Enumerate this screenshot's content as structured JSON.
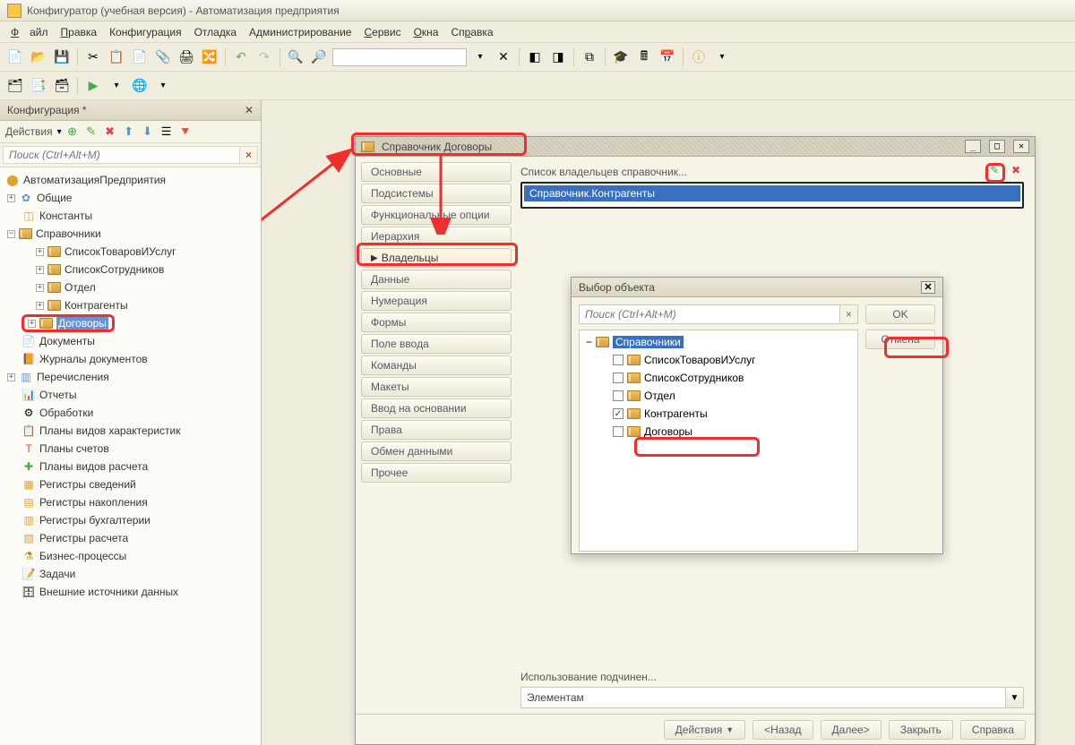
{
  "app": {
    "title": "Конфигуратор (учебная версия) - Автоматизация предприятия"
  },
  "menu": {
    "items": [
      "Файл",
      "Правка",
      "Конфигурация",
      "Отладка",
      "Администрирование",
      "Сервис",
      "Окна",
      "Справка"
    ]
  },
  "toolbar": {
    "search_placeholder": ""
  },
  "config_panel": {
    "title": "Конфигурация *",
    "actions_label": "Действия",
    "search_placeholder": "Поиск (Ctrl+Alt+M)",
    "root": "АвтоматизацияПредприятия",
    "nodes": [
      {
        "label": "Общие",
        "icon": "🔶"
      },
      {
        "label": "Константы",
        "icon": "cat"
      },
      {
        "label": "Справочники",
        "icon": "cat",
        "expanded": true,
        "children": [
          {
            "label": "СписокТоваровИУслуг"
          },
          {
            "label": "СписокСотрудников"
          },
          {
            "label": "Отдел"
          },
          {
            "label": "Контрагенты"
          },
          {
            "label": "Договоры",
            "selected": true,
            "highlighted": true
          }
        ]
      },
      {
        "label": "Документы",
        "icon": "📄"
      },
      {
        "label": "Журналы документов",
        "icon": "📙"
      },
      {
        "label": "Перечисления",
        "icon": "🔢"
      },
      {
        "label": "Отчеты",
        "icon": "📊"
      },
      {
        "label": "Обработки",
        "icon": "⚙"
      },
      {
        "label": "Планы видов характеристик",
        "icon": "📋"
      },
      {
        "label": "Планы счетов",
        "icon": "Т"
      },
      {
        "label": "Планы видов расчета",
        "icon": "💹"
      },
      {
        "label": "Регистры сведений",
        "icon": "☷"
      },
      {
        "label": "Регистры накопления",
        "icon": "📈"
      },
      {
        "label": "Регистры бухгалтерии",
        "icon": "📒"
      },
      {
        "label": "Регистры расчета",
        "icon": "🧮"
      },
      {
        "label": "Бизнес-процессы",
        "icon": "⚗"
      },
      {
        "label": "Задачи",
        "icon": "📝"
      },
      {
        "label": "Внешние источники данных",
        "icon": "🗄"
      }
    ]
  },
  "dialog": {
    "title": "Справочник Договоры",
    "tabs": [
      "Основные",
      "Подсистемы",
      "Функциональные опции",
      "Иерархия",
      "Владельцы",
      "Данные",
      "Нумерация",
      "Формы",
      "Поле ввода",
      "Команды",
      "Макеты",
      "Ввод на основании",
      "Права",
      "Обмен данными",
      "Прочее"
    ],
    "active_tab": "Владельцы",
    "owners_label": "Список владельцев справочник...",
    "owners_item": "Справочник.Контрагенты",
    "usage_label": "Использование подчинен...",
    "usage_value": "Элементам",
    "footer": {
      "actions": "Действия",
      "back": "<Назад",
      "next": "Далее>",
      "close": "Закрыть",
      "help": "Справка"
    }
  },
  "chooser": {
    "title": "Выбор объекта",
    "search_placeholder": "Поиск (Ctrl+Alt+M)",
    "root": "Справочники",
    "items": [
      {
        "label": "СписокТоваровИУслуг",
        "checked": false
      },
      {
        "label": "СписокСотрудников",
        "checked": false
      },
      {
        "label": "Отдел",
        "checked": false
      },
      {
        "label": "Контрагенты",
        "checked": true,
        "highlighted": true
      },
      {
        "label": "Договоры",
        "checked": false
      }
    ],
    "ok": "OK",
    "cancel": "Отмена"
  }
}
